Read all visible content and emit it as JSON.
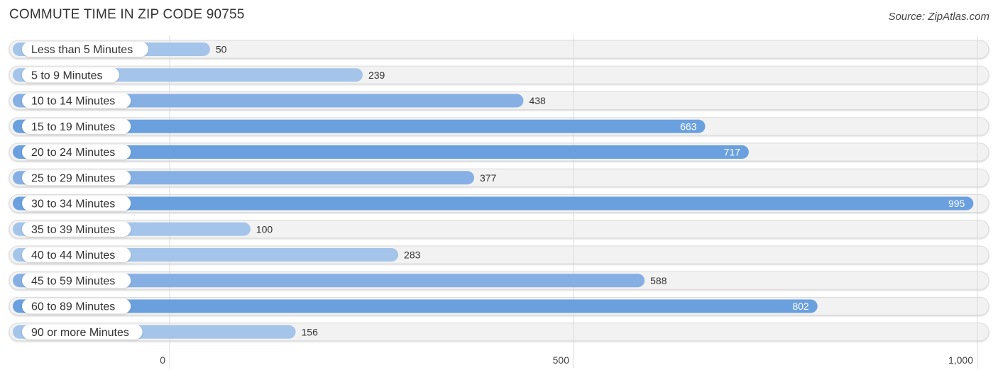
{
  "header": {
    "title": "COMMUTE TIME IN ZIP CODE 90755",
    "source": "Source: ZipAtlas.com"
  },
  "colors": {
    "bar_light": "#a4c4ea",
    "bar_mid": "#86b0e4",
    "bar_dark": "#6aa0de",
    "track": "#f2f2f2",
    "track_border": "#dcdcdc",
    "grid": "#d9d9d9",
    "value_inside": "#ffffff",
    "value_outside": "#333333"
  },
  "chart_data": {
    "type": "bar",
    "orientation": "horizontal",
    "title": "COMMUTE TIME IN ZIP CODE 90755",
    "xlabel": "",
    "ylabel": "",
    "categories": [
      "Less than 5 Minutes",
      "5 to 9 Minutes",
      "10 to 14 Minutes",
      "15 to 19 Minutes",
      "20 to 24 Minutes",
      "25 to 29 Minutes",
      "30 to 34 Minutes",
      "35 to 39 Minutes",
      "40 to 44 Minutes",
      "45 to 59 Minutes",
      "60 to 89 Minutes",
      "90 or more Minutes"
    ],
    "values": [
      50,
      239,
      438,
      663,
      717,
      377,
      995,
      100,
      283,
      588,
      802,
      156
    ],
    "value_labels": [
      "50",
      "239",
      "438",
      "663",
      "717",
      "377",
      "995",
      "100",
      "283",
      "588",
      "802",
      "156"
    ],
    "xlim": [
      0,
      1000
    ],
    "xticks": [
      0,
      500,
      1000
    ],
    "xtick_labels": [
      "0",
      "500",
      "1,000"
    ],
    "grid": true,
    "legend": "none"
  }
}
